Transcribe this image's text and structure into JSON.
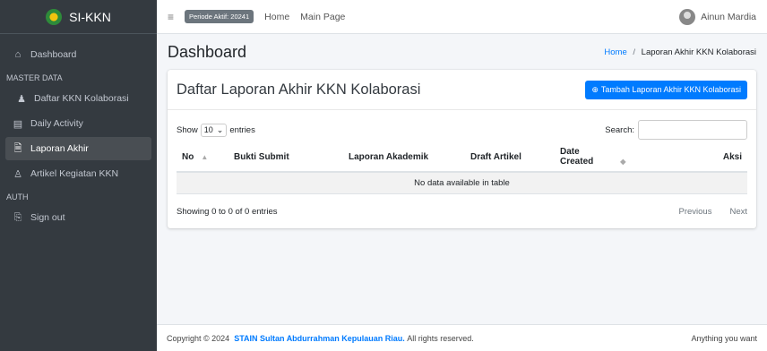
{
  "brand": {
    "name": "SI-KKN"
  },
  "sidebar": {
    "dashboard": "Dashboard",
    "master_header": "MASTER DATA",
    "items": [
      {
        "label": "Daftar KKN Kolaborasi",
        "icon": "user-icon"
      },
      {
        "label": "Daily Activity",
        "icon": "keyboard-icon"
      },
      {
        "label": "Laporan Akhir",
        "icon": "file-icon"
      },
      {
        "label": "Artikel Kegiatan KKN",
        "icon": "users-icon"
      }
    ],
    "auth_header": "AUTH",
    "signout": "Sign out"
  },
  "topbar": {
    "period": "Periode Aktif: 20241",
    "home": "Home",
    "main_page": "Main Page",
    "user_name": "Ainun Mardia"
  },
  "page": {
    "title": "Dashboard",
    "breadcrumb_home": "Home",
    "breadcrumb_sep": "/",
    "breadcrumb_current": "Laporan Akhir KKN Kolaborasi"
  },
  "card": {
    "title": "Daftar Laporan Akhir KKN Kolaborasi",
    "add_button": "Tambah Laporan Akhir KKN Kolaborasi"
  },
  "table": {
    "show_label": "Show",
    "length_value": "10",
    "entries_label": "entries",
    "search_label": "Search:",
    "search_value": "",
    "columns": [
      "No",
      "Bukti Submit",
      "Laporan Akademik",
      "Draft Artikel",
      "Date Created",
      "Aksi"
    ],
    "empty_message": "No data available in table",
    "info": "Showing 0 to 0 of 0 entries",
    "prev": "Previous",
    "next": "Next"
  },
  "footer": {
    "prefix": "Copyright © 2024",
    "org": "STAIN Sultan Abdurrahman Kepulauan Riau.",
    "suffix": "All rights reserved.",
    "right": "Anything you want"
  },
  "colors": {
    "primary": "#007bff",
    "sidebar_bg": "#343a40",
    "active_item": "#494e53"
  }
}
